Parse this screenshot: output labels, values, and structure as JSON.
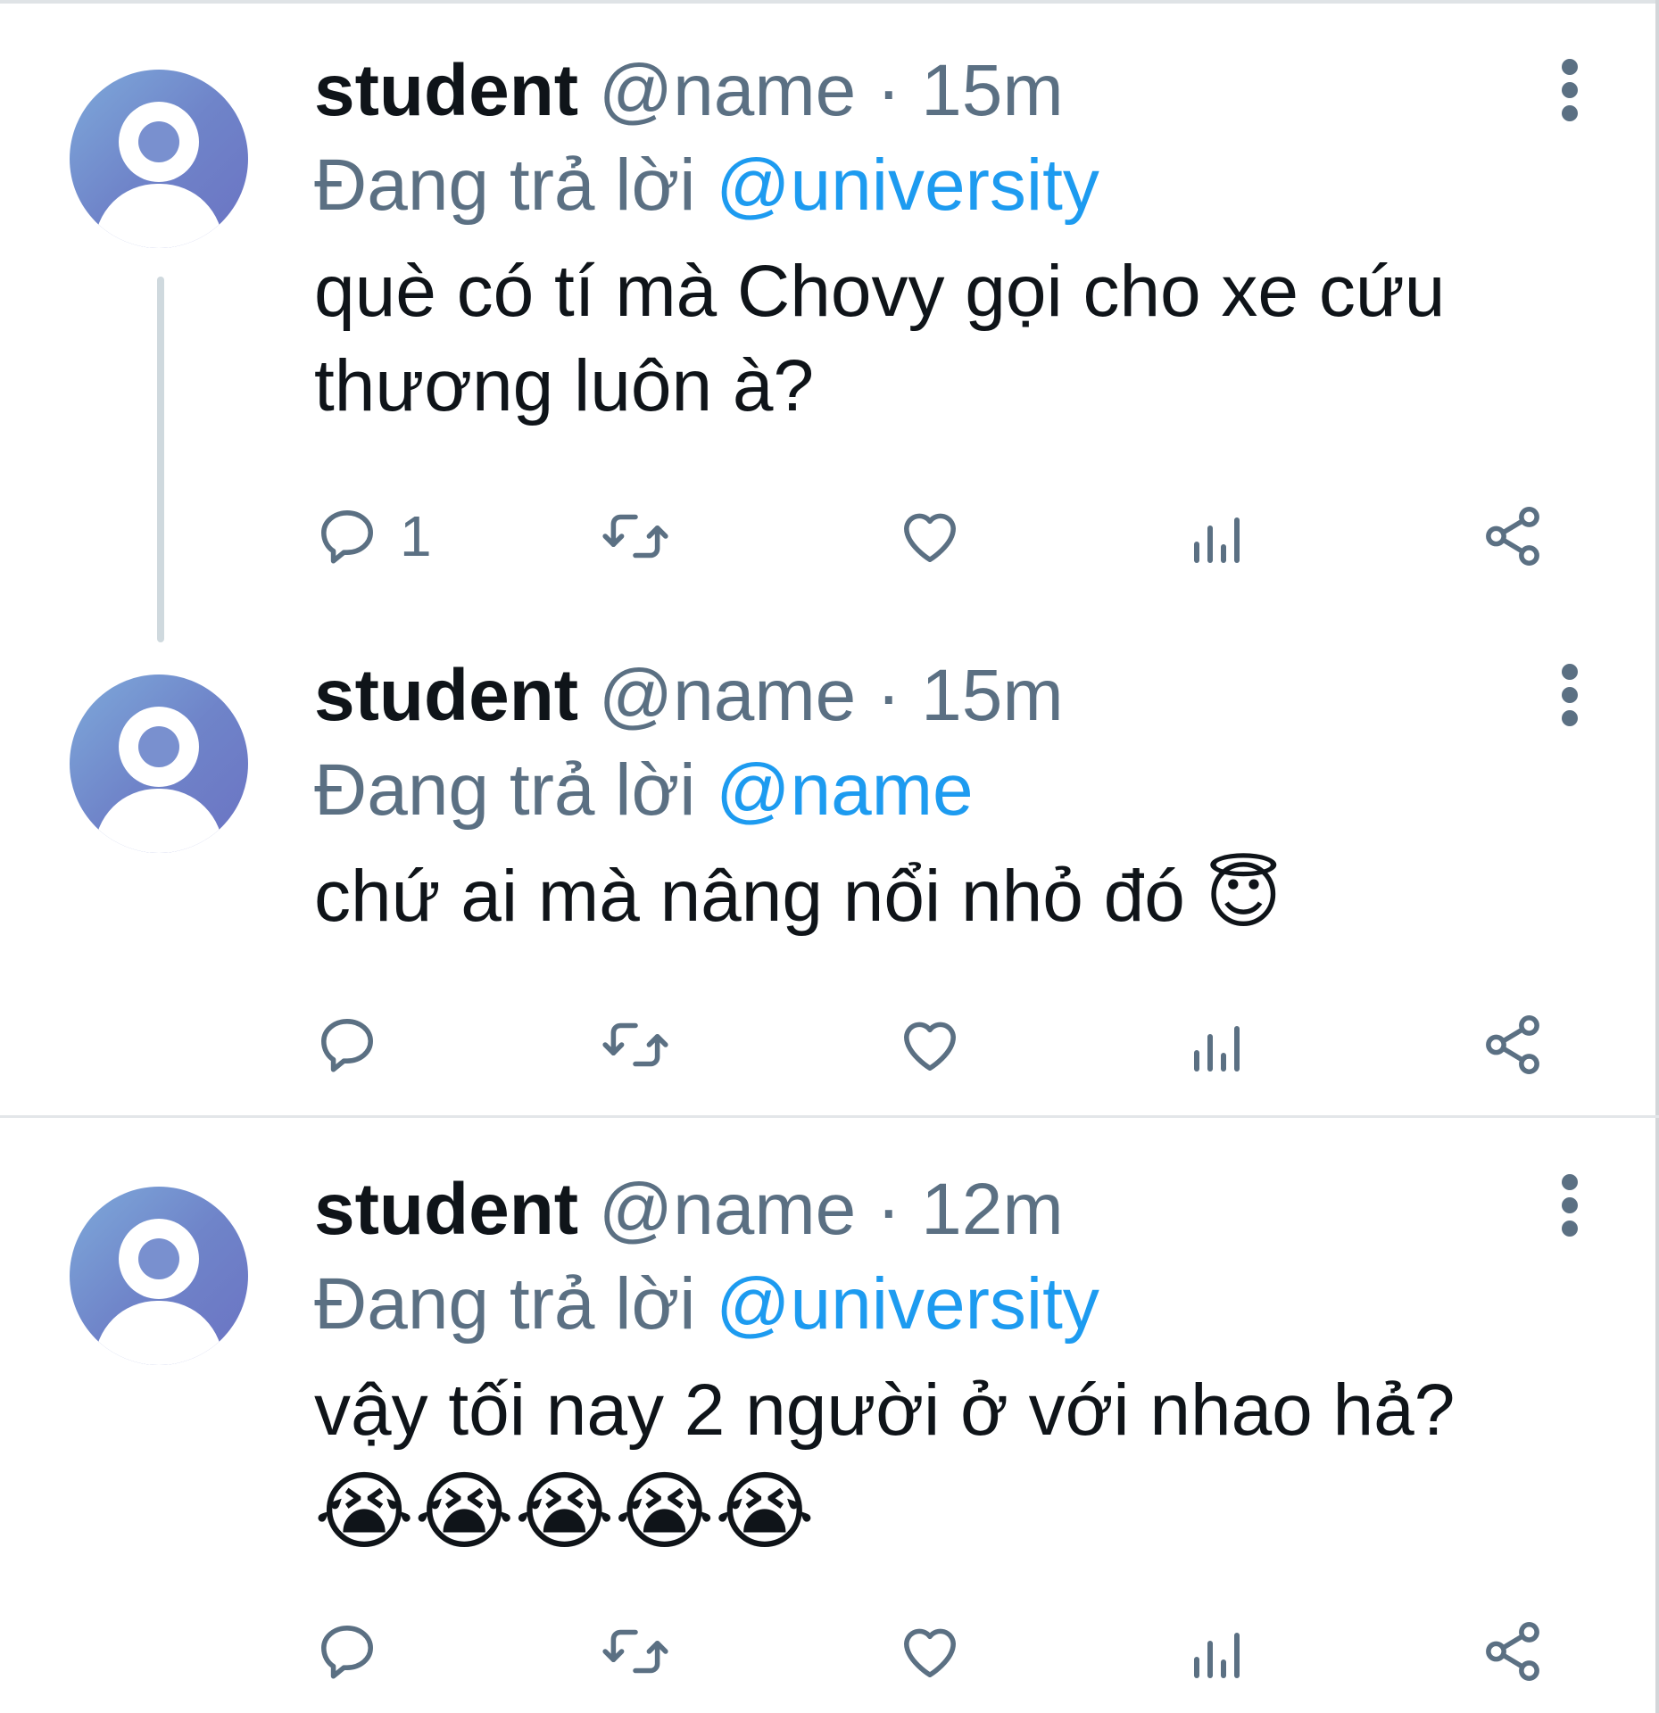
{
  "tweets": [
    {
      "name": "student",
      "handle": "@name",
      "separator": "·",
      "time": "15m",
      "reply_prefix": "Đang trả lời",
      "reply_to": "@university",
      "text": "què có tí mà Chovy gọi cho xe cứu thương luôn à?",
      "reply_count": "1"
    },
    {
      "name": "student",
      "handle": "@name",
      "separator": "·",
      "time": "15m",
      "reply_prefix": "Đang trả lời",
      "reply_to": "@name",
      "text": "chứ ai mà nâng nổi nhỏ đó",
      "emoji": "😇",
      "reply_count": ""
    },
    {
      "name": "student",
      "handle": "@name",
      "separator": "·",
      "time": "12m",
      "reply_prefix": "Đang trả lời",
      "reply_to": "@university",
      "text": "vậy tối nay 2 người ở với nhao hả?",
      "emoji": "😭😭😭😭😭",
      "reply_count": ""
    }
  ],
  "colors": {
    "text": "#0f1419",
    "secondary": "#5b7083",
    "link": "#1d9bf0",
    "divider": "#e3e6e9",
    "avatar": "#6f84c9"
  },
  "icons": [
    "reply-icon",
    "retweet-icon",
    "like-icon",
    "views-icon",
    "share-icon",
    "more-icon"
  ]
}
